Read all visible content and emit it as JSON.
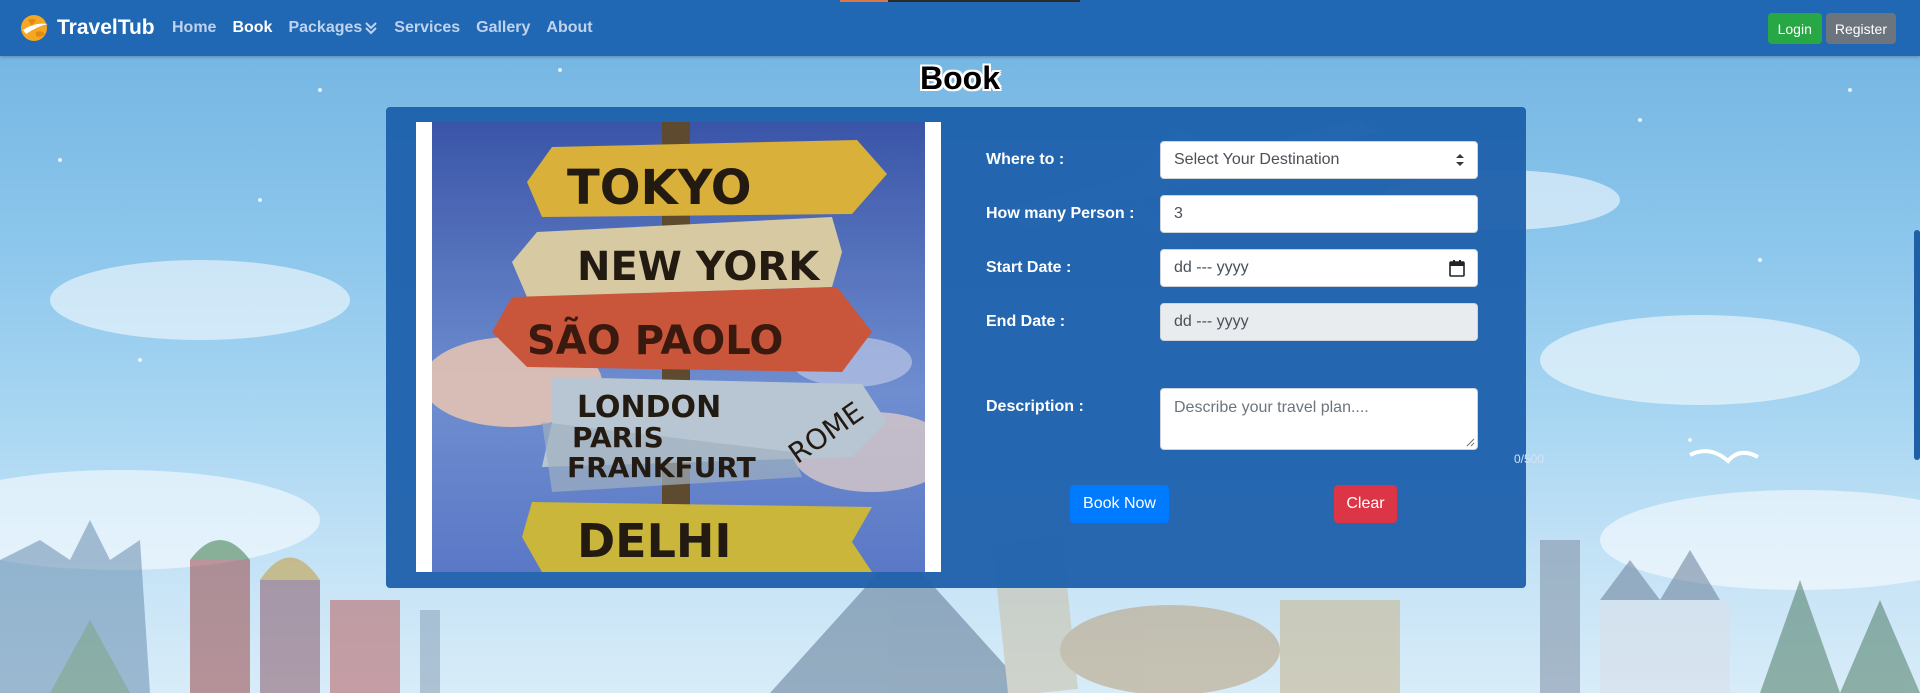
{
  "brand": {
    "name": "TravelTub"
  },
  "nav": {
    "links": [
      {
        "label": "Home"
      },
      {
        "label": "Book"
      },
      {
        "label": "Packages"
      },
      {
        "label": "Services"
      },
      {
        "label": "Gallery"
      },
      {
        "label": "About"
      }
    ],
    "login_label": "Login",
    "register_label": "Register"
  },
  "page": {
    "title": "Book"
  },
  "photo": {
    "signs": [
      "TOKYO",
      "NEW YORK",
      "SÃO PAOLO",
      "LONDON",
      "PARIS",
      "FRANKFURT",
      "ROME",
      "DELHI"
    ]
  },
  "form": {
    "destination": {
      "label": "Where to :",
      "value": "Select Your Destination"
    },
    "persons": {
      "label": "How many Person :",
      "value": "3"
    },
    "start_date": {
      "label": "Start Date :",
      "placeholder": "dd --- yyyy"
    },
    "end_date": {
      "label": "End Date :",
      "placeholder": "dd --- yyyy"
    },
    "description": {
      "label": "Description :",
      "placeholder": "Describe your travel plan....",
      "counter": "0/500"
    },
    "book_label": "Book Now",
    "clear_label": "Clear"
  },
  "colors": {
    "navbar": "#2168b4",
    "card": "#1d60ac",
    "book": "#007bff",
    "clear": "#dc3545",
    "login": "#28a745",
    "register": "#6c757d"
  }
}
